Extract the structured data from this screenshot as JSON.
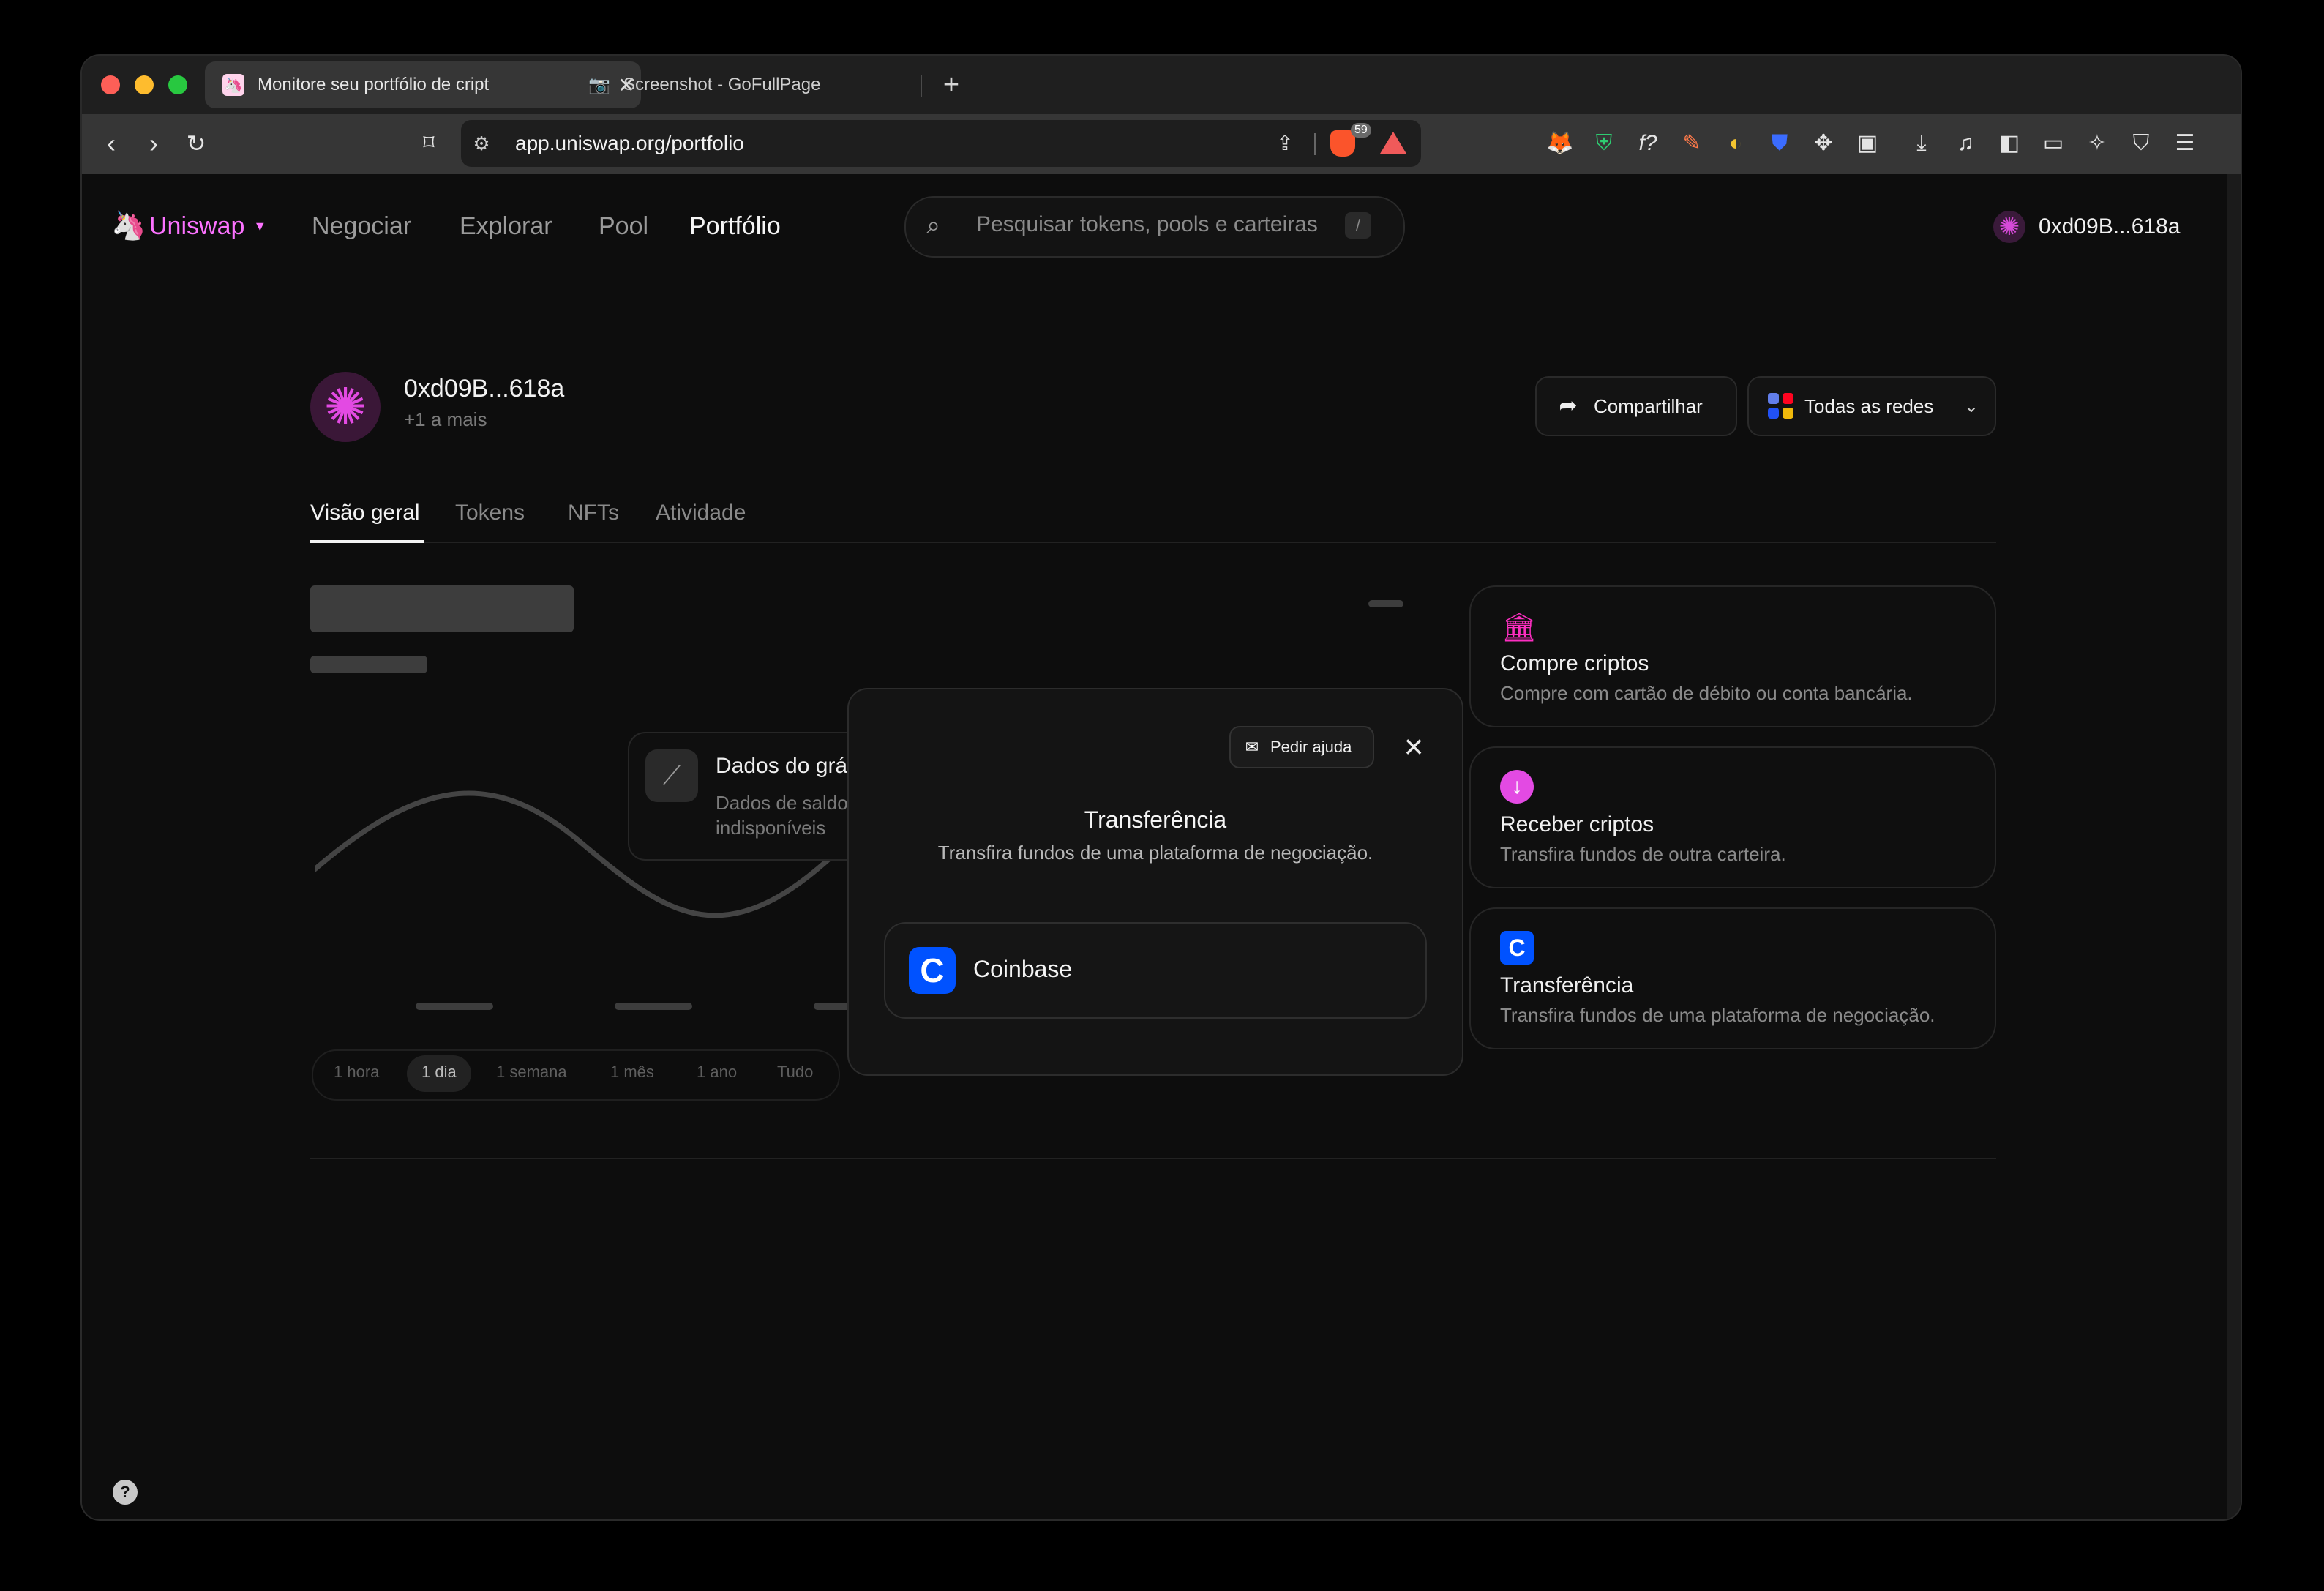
{
  "browser": {
    "tabs": [
      {
        "title": "Monitore seu portfólio de cript",
        "active": true
      },
      {
        "title": "Screenshot - GoFullPage",
        "active": false
      }
    ],
    "new_tab": "+",
    "close_glyph": "✕",
    "url": "app.uniswap.org/portfolio",
    "brave_shield_count": "59"
  },
  "header": {
    "logo_text": "Uniswap",
    "nav": [
      "Negociar",
      "Explorar",
      "Pool",
      "Portfólio"
    ],
    "active_nav": "Portfólio",
    "search_placeholder": "Pesquisar tokens, pools e carteiras",
    "search_shortcut": "/",
    "account": "0xd09B...618a"
  },
  "profile": {
    "address": "0xd09B...618a",
    "subtitle": "+1 a mais",
    "share_label": "Compartilhar",
    "networks_label": "Todas as redes"
  },
  "tabs": [
    "Visão geral",
    "Tokens",
    "NFTs",
    "Atividade"
  ],
  "active_tab": "Visão geral",
  "chart": {
    "no_data_title": "Dados do gráfico",
    "no_data_desc": "Dados de saldo indisponíveis",
    "time_ranges": [
      "1 hora",
      "1 dia",
      "1 semana",
      "1 mês",
      "1 ano",
      "Tudo"
    ],
    "active_range": "1 dia"
  },
  "actions": [
    {
      "title": "Compre criptos",
      "desc": "Compre com cartão de débito ou conta bancária.",
      "icon": "bank-icon",
      "color": "#fc2ec0"
    },
    {
      "title": "Receber criptos",
      "desc": "Transfira fundos de outra carteira.",
      "icon": "arrow-down-circle-icon",
      "color": "#e34ae3"
    },
    {
      "title": "Transferência",
      "desc": "Transfira fundos de uma plataforma de negociação.",
      "icon": "coinbase-icon",
      "color": "#0052ff"
    }
  ],
  "modal": {
    "help_label": "Pedir ajuda",
    "title": "Transferência",
    "description": "Transfira fundos de uma plataforma de negociação.",
    "providers": [
      {
        "name": "Coinbase"
      }
    ]
  },
  "colors": {
    "accent": "#fc72ff",
    "coinbase": "#0052ff",
    "background": "#0d0d0d"
  }
}
